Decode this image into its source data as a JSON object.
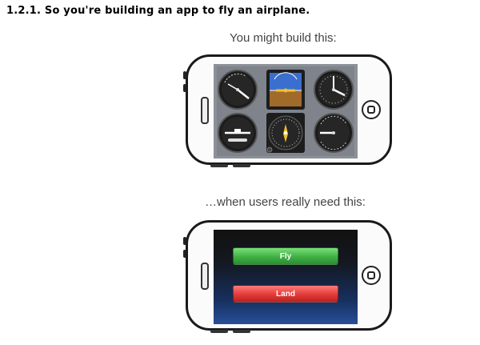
{
  "heading": "1.2.1. So you're building an app to fly an airplane.",
  "caption_top": "You might build this:",
  "caption_bottom": "…when users really need this:",
  "phone_cockpit": {
    "screen": "flight instrument panel",
    "instruments": [
      "airspeed-indicator",
      "attitude-indicator",
      "altimeter",
      "turn-coordinator",
      "heading-indicator",
      "vertical-speed-indicator"
    ]
  },
  "phone_simple": {
    "buttons": [
      {
        "label": "Fly",
        "color": "#3fb043"
      },
      {
        "label": "Land",
        "color": "#e23a38"
      }
    ]
  }
}
